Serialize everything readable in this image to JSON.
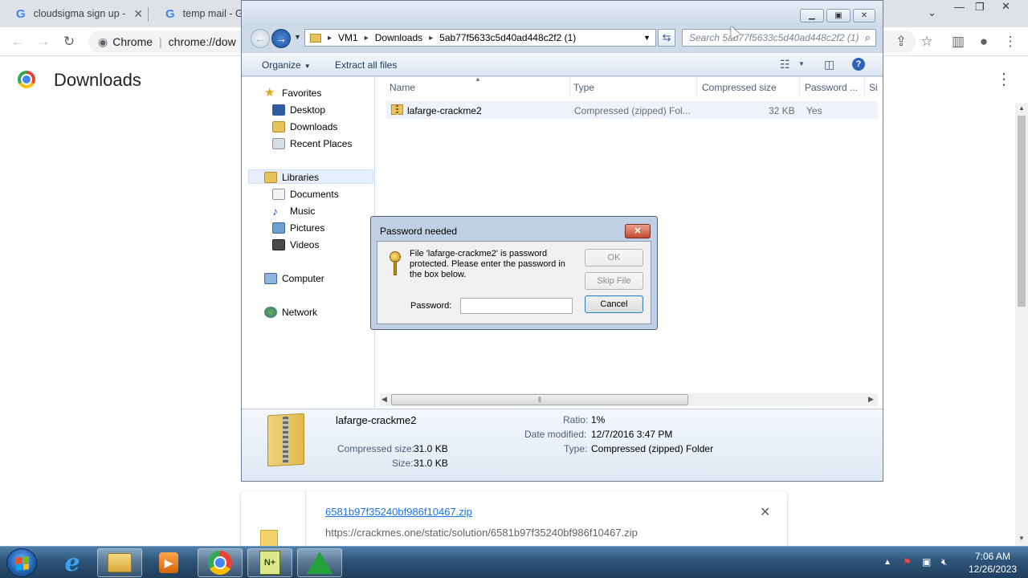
{
  "browser": {
    "tabs": [
      {
        "title": "cloudsigma sign up -",
        "icon": "google-g-icon"
      },
      {
        "title": "temp mail - Go",
        "icon": "google-g-icon"
      }
    ],
    "omnibox": {
      "site_label": "Chrome",
      "url": "chrome://dow"
    },
    "page_title": "Downloads",
    "download_card": {
      "filename": "6581b97f35240bf986f10467.zip",
      "url": "https://crackmes.one/static/solution/6581b97f35240bf986f10467.zip"
    }
  },
  "explorer": {
    "breadcrumb": [
      "VM1",
      "Downloads",
      "5ab77f5633c5d40ad448c2f2 (1)"
    ],
    "search_placeholder": "Search 5ab77f5633c5d40ad448c2f2 (1)",
    "commands": {
      "organize": "Organize",
      "extract": "Extract all files"
    },
    "nav": {
      "favorites": "Favorites",
      "desktop": "Desktop",
      "downloads": "Downloads",
      "recent_places": "Recent Places",
      "libraries": "Libraries",
      "documents": "Documents",
      "music": "Music",
      "pictures": "Pictures",
      "videos": "Videos",
      "computer": "Computer",
      "network": "Network"
    },
    "columns": [
      "Name",
      "Type",
      "Compressed size",
      "Password ...",
      "Si"
    ],
    "files": [
      {
        "name": "lafarge-crackme2",
        "type": "Compressed (zipped) Fol...",
        "compressed_size": "32 KB",
        "password": "Yes"
      }
    ],
    "details": {
      "name": "lafarge-crackme2",
      "compressed_size_label": "Compressed size:",
      "compressed_size": "31.0 KB",
      "size_label": "Size:",
      "size": "31.0 KB",
      "ratio_label": "Ratio:",
      "ratio": "1%",
      "modified_label": "Date modified:",
      "modified": "12/7/2016 3:47 PM",
      "type_label": "Type:",
      "type": "Compressed (zipped) Folder"
    }
  },
  "password_dialog": {
    "title": "Password needed",
    "message": "File 'lafarge-crackme2' is password protected.  Please enter the password in the box below.",
    "ok": "OK",
    "skip": "Skip File",
    "cancel": "Cancel",
    "password_label": "Password:",
    "password_value": ""
  },
  "taskbar": {
    "clock_time": "7:06 AM",
    "clock_date": "12/26/2023"
  }
}
